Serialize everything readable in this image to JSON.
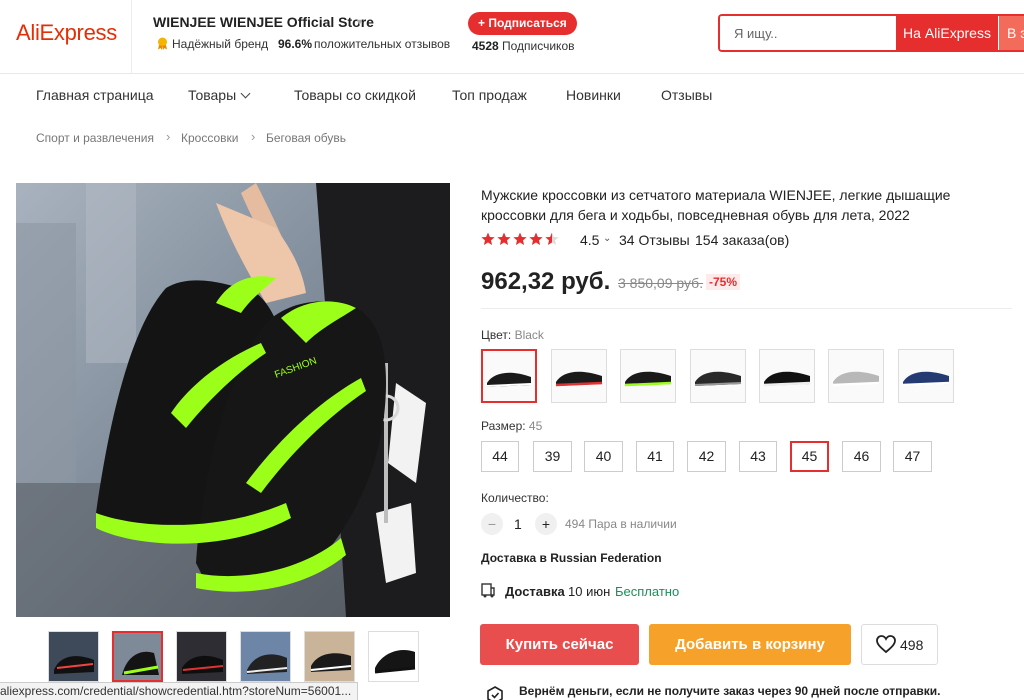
{
  "header": {
    "logo": "AliExpress",
    "store_name": "WIENJEE WIENJEE Official Store",
    "brand_label": "Надёжный бренд",
    "rating_pct": "96.6%",
    "rating_text": "положительных отзывов",
    "subscribe_label": "+ Подписаться",
    "followers_count": "4528",
    "followers_label": "Подписчиков",
    "search_placeholder": "Я ищу..",
    "search_ali_label": "На AliExpress",
    "search_all_label": "В э",
    "accent_color": "#e62e2e"
  },
  "nav": {
    "items": [
      "Главная страница",
      "Товары",
      "Товары со скидкой",
      "Топ продаж",
      "Новинки",
      "Отзывы"
    ]
  },
  "breadcrumb": [
    "Спорт и развлечения",
    "Кроссовки",
    "Беговая обувь"
  ],
  "product": {
    "title": "Мужские кроссовки из сетчатого материала WIENJEE, легкие дышащие кроссовки для бега и ходьбы, повседневная обувь для лета, 2022",
    "rating": "4.5",
    "stars": 4.5,
    "reviews": "34 Отзывы",
    "orders": "154 заказа(ов)",
    "price": "962,32 руб.",
    "old_price": "3 850,09 руб.",
    "discount": "-75%",
    "color_label": "Цвет:",
    "color_value": "Black",
    "color_swatches": [
      "black-white",
      "black-red",
      "black-green",
      "black-gray",
      "black-black",
      "gray",
      "navy"
    ],
    "size_label": "Размер:",
    "size_value": "45",
    "sizes": [
      "44",
      "39",
      "40",
      "41",
      "42",
      "43",
      "45",
      "46",
      "47"
    ],
    "selected_size": "45",
    "qty_label": "Количество:",
    "qty_value": "1",
    "qty_minus": "−",
    "qty_plus": "+",
    "stock": "494 Пара в наличии",
    "delivery_to": "Доставка в Russian Federation",
    "delivery_label": "Доставка",
    "delivery_date": "10 июн",
    "delivery_free": "Бесплатно",
    "buy_label": "Купить сейчас",
    "cart_label": "Добавить в корзину",
    "wish_count": "498",
    "guarantee": "Вернём деньги, если не получите заказ через 90 дней после отправки."
  },
  "thumbnails_count": 6,
  "status_bar": {
    "url": "aliexpress.com/credential/showcredential.htm?storeNum=56001..."
  },
  "icons": {
    "badge": "brand-badge-icon",
    "truck": "truck-icon",
    "heart": "heart-icon",
    "shield": "shield-icon",
    "star": "star-icon"
  }
}
